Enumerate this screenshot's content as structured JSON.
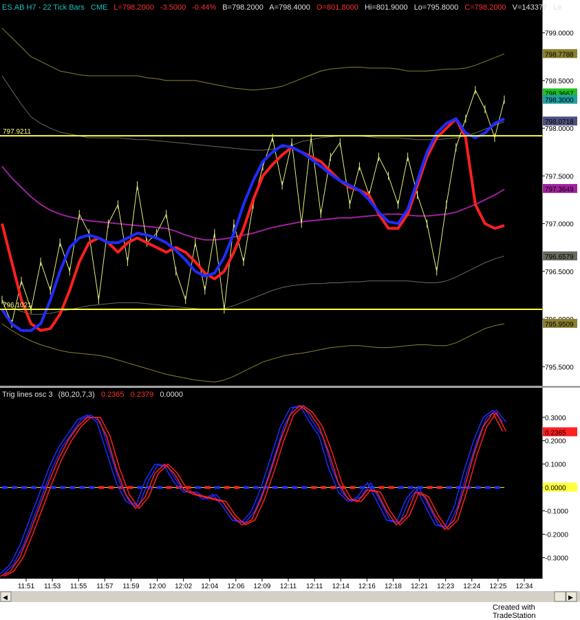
{
  "header": {
    "symbol": "ES.AB H7 - 22 Tick Bars",
    "exchange": "CME",
    "last": "L=798.2000",
    "change": "-3.5000",
    "change_pct": "-0.44%",
    "bid": "B=798.2000",
    "ask": "A=798.4000",
    "open": "O=801.8000",
    "high": "Hi=801.9000",
    "low": "Lo=795.8000",
    "close": "C=798.2000",
    "volume": "V=143377",
    "more": "Le"
  },
  "osc_header": {
    "name": "Trig lines osc 3",
    "params": "(80,20,7,3)",
    "v1": "0.2365",
    "v2": "0.2379",
    "v3": "0.0000"
  },
  "footer": {
    "credit": "Created with TradeStation"
  },
  "colors": {
    "background": "#000000",
    "price_line": "#e8f07a",
    "red_line": "#ff2020",
    "blue_line": "#1f2cff",
    "purple_line": "#a020a0",
    "band_outer": "#8a8030",
    "band_inner": "#6a6a60",
    "hline": "#ffff40"
  },
  "chart_data": [
    {
      "type": "line",
      "title": "",
      "ylim": [
        795.3,
        799.2
      ],
      "y_ticks": [
        "799.0000",
        "798.5000",
        "798.0000",
        "797.5000",
        "797.0000",
        "796.5000",
        "796.0000",
        "795.5000"
      ],
      "y_tick_values": [
        799.0,
        798.5,
        798.0,
        797.5,
        797.0,
        796.5,
        796.0,
        795.5
      ],
      "x_ticks": [
        "11:51",
        "11:53",
        "11:55",
        "11:57",
        "11:59",
        "12:00",
        "12:02",
        "12:04",
        "12:06",
        "12:09",
        "12:11",
        "12:11",
        "12:14",
        "12:16",
        "12:18",
        "12:21",
        "12:23",
        "12:24",
        "12:25",
        "12:34"
      ],
      "horizontal_lines": [
        {
          "label": "797.9211",
          "value": 797.9211
        },
        {
          "label": "796.1021",
          "value": 796.1021
        }
      ],
      "right_tags": [
        {
          "label": "798.7788",
          "value": 798.7788,
          "color": "#8a8030"
        },
        {
          "label": "798.3667",
          "value": 798.3667,
          "color": "#20c020"
        },
        {
          "label": "798.3000",
          "value": 798.3,
          "color": "#20a0a0"
        },
        {
          "label": "798.0718",
          "value": 798.0718,
          "color": "#505080"
        },
        {
          "label": "797.3649",
          "value": 797.3649,
          "color": "#a020a0"
        },
        {
          "label": "796.6579",
          "value": 796.6579,
          "color": "#6a6a60"
        },
        {
          "label": "795.9509",
          "value": 795.9509,
          "color": "#8a8030"
        }
      ],
      "series": [
        {
          "key": "band_upper_outer",
          "values": [
            799.05,
            798.95,
            798.85,
            798.75,
            798.7,
            798.65,
            798.6,
            798.58,
            798.56,
            798.55,
            798.55,
            798.55,
            798.55,
            798.55,
            798.55,
            798.53,
            798.52,
            798.5,
            798.5,
            798.5,
            798.5,
            798.48,
            798.46,
            798.44,
            798.42,
            798.41,
            798.4,
            798.41,
            798.42,
            798.44,
            798.48,
            798.52,
            798.56,
            798.6,
            798.62,
            798.63,
            798.64,
            798.64,
            798.63,
            798.63,
            798.63,
            798.62,
            798.6,
            798.6,
            798.6,
            798.61,
            798.62,
            798.62,
            798.63,
            798.66,
            798.7,
            798.74,
            798.78
          ]
        },
        {
          "key": "band_upper_inner",
          "values": [
            798.55,
            798.4,
            798.25,
            798.12,
            798.05,
            798.0,
            797.96,
            797.94,
            797.92,
            797.9,
            797.9,
            797.9,
            797.9,
            797.89,
            797.88,
            797.88,
            797.87,
            797.86,
            797.85,
            797.84,
            797.83,
            797.82,
            797.81,
            797.8,
            797.79,
            797.78,
            797.77,
            797.77,
            797.78,
            797.8,
            797.82,
            797.86,
            797.88,
            797.9,
            797.91,
            797.92,
            797.92,
            797.92,
            797.91,
            797.9,
            797.9,
            797.9,
            797.89,
            797.88,
            797.88,
            797.88,
            797.89,
            797.9,
            797.92,
            797.95,
            797.99,
            798.03,
            798.07
          ]
        },
        {
          "key": "band_lower_inner",
          "values": [
            796.2,
            796.12,
            796.08,
            796.05,
            796.05,
            796.06,
            796.08,
            796.1,
            796.12,
            796.14,
            796.15,
            796.16,
            796.17,
            796.17,
            796.17,
            796.16,
            796.15,
            796.14,
            796.13,
            796.12,
            796.11,
            796.1,
            796.1,
            796.11,
            796.14,
            796.18,
            796.22,
            796.26,
            796.3,
            796.33,
            796.35,
            796.36,
            796.37,
            796.37,
            796.38,
            796.38,
            796.39,
            796.39,
            796.4,
            796.4,
            796.4,
            796.4,
            796.4,
            796.39,
            796.38,
            796.38,
            796.4,
            796.44,
            796.49,
            796.54,
            796.59,
            796.63,
            796.66
          ]
        },
        {
          "key": "band_lower_outer",
          "values": [
            795.95,
            795.88,
            795.82,
            795.77,
            795.73,
            795.7,
            795.67,
            795.65,
            795.64,
            795.63,
            795.62,
            795.6,
            795.57,
            795.54,
            795.51,
            795.48,
            795.45,
            795.42,
            795.4,
            795.38,
            795.36,
            795.35,
            795.34,
            795.36,
            795.4,
            795.45,
            795.5,
            795.55,
            795.58,
            795.61,
            795.63,
            795.64,
            795.66,
            795.68,
            795.7,
            795.71,
            795.72,
            795.72,
            795.71,
            795.7,
            795.7,
            795.71,
            795.72,
            795.73,
            795.73,
            795.72,
            795.72,
            795.75,
            795.8,
            795.85,
            795.9,
            795.93,
            795.95
          ]
        },
        {
          "key": "purple_avg",
          "values": [
            797.6,
            797.48,
            797.38,
            797.28,
            797.2,
            797.14,
            797.1,
            797.07,
            797.05,
            797.03,
            797.02,
            797.01,
            797.0,
            796.99,
            796.98,
            796.97,
            796.96,
            796.95,
            796.92,
            796.88,
            796.85,
            796.83,
            796.83,
            796.84,
            796.86,
            796.88,
            796.9,
            796.93,
            796.96,
            796.98,
            797.0,
            797.02,
            797.03,
            797.04,
            797.05,
            797.06,
            797.06,
            797.07,
            797.08,
            797.09,
            797.1,
            797.1,
            797.09,
            797.08,
            797.08,
            797.09,
            797.1,
            797.12,
            797.16,
            797.2,
            797.25,
            797.3,
            797.36
          ]
        },
        {
          "key": "price",
          "values": [
            796.2,
            795.95,
            796.4,
            796.1,
            796.6,
            796.3,
            796.8,
            796.5,
            797.1,
            796.9,
            796.2,
            797.0,
            797.2,
            796.6,
            797.4,
            796.8,
            796.9,
            797.1,
            796.5,
            796.2,
            796.8,
            796.3,
            796.9,
            796.1,
            797.0,
            796.6,
            797.2,
            797.6,
            797.9,
            797.4,
            797.85,
            797.0,
            797.9,
            797.1,
            797.7,
            797.85,
            797.2,
            797.6,
            797.3,
            797.7,
            797.5,
            797.2,
            797.7,
            797.3,
            797.0,
            796.5,
            797.2,
            797.8,
            798.1,
            798.4,
            798.2,
            797.9,
            798.3
          ]
        },
        {
          "key": "red_slow",
          "values": [
            797.0,
            796.6,
            796.2,
            795.95,
            795.88,
            795.9,
            796.05,
            796.3,
            796.6,
            796.8,
            796.85,
            796.8,
            796.7,
            796.8,
            796.85,
            796.8,
            796.75,
            796.7,
            796.75,
            796.7,
            796.6,
            796.48,
            796.42,
            796.5,
            796.7,
            796.95,
            797.25,
            797.5,
            797.62,
            797.72,
            797.8,
            797.75,
            797.7,
            797.65,
            797.55,
            797.45,
            797.38,
            797.35,
            797.3,
            797.1,
            796.95,
            796.95,
            797.1,
            797.4,
            797.7,
            797.9,
            798.0,
            798.1,
            797.9,
            797.2,
            797.0,
            796.95,
            796.98
          ]
        },
        {
          "key": "blue_slow",
          "values": [
            796.1,
            795.95,
            795.88,
            795.88,
            795.95,
            796.2,
            796.5,
            796.75,
            796.85,
            796.88,
            796.85,
            796.8,
            796.8,
            796.85,
            796.9,
            796.88,
            796.85,
            796.8,
            796.72,
            796.62,
            796.5,
            796.45,
            796.48,
            796.65,
            796.9,
            797.2,
            797.45,
            797.65,
            797.75,
            797.82,
            797.8,
            797.75,
            797.68,
            797.6,
            797.52,
            797.45,
            797.4,
            797.35,
            797.25,
            797.12,
            797.02,
            797.0,
            797.15,
            797.45,
            797.75,
            797.95,
            798.05,
            798.1,
            797.95,
            797.9,
            797.95,
            798.05,
            798.1
          ]
        }
      ]
    },
    {
      "type": "line",
      "title": "Trig lines osc 3",
      "ylim": [
        -0.39,
        0.37
      ],
      "y_ticks": [
        "0.3000",
        "0.2000",
        "0.1000",
        "0.0000",
        "-0.1000",
        "-0.2000",
        "-0.3000"
      ],
      "y_tick_values": [
        0.3,
        0.2,
        0.1,
        0.0,
        -0.1,
        -0.2,
        -0.3
      ],
      "right_tags": [
        {
          "label": "0.2365",
          "value": 0.2365,
          "color": "#ff2020"
        },
        {
          "label": "0.0000",
          "value": 0.0,
          "color": "#ffff40"
        }
      ],
      "series": [
        {
          "key": "osc_blue",
          "values": [
            -0.37,
            -0.33,
            -0.25,
            -0.14,
            -0.03,
            0.08,
            0.17,
            0.23,
            0.29,
            0.31,
            0.28,
            0.15,
            0.02,
            -0.06,
            -0.08,
            0.03,
            0.1,
            0.09,
            0.02,
            -0.02,
            -0.02,
            -0.05,
            -0.03,
            -0.08,
            -0.14,
            -0.15,
            -0.1,
            0.0,
            0.13,
            0.26,
            0.34,
            0.35,
            0.28,
            0.22,
            0.08,
            -0.02,
            -0.06,
            -0.04,
            0.02,
            -0.06,
            -0.14,
            -0.15,
            -0.05,
            0.0,
            -0.08,
            -0.16,
            -0.17,
            -0.08,
            0.07,
            0.2,
            0.3,
            0.33,
            0.28
          ]
        },
        {
          "key": "osc_red",
          "values": [
            -0.38,
            -0.36,
            -0.3,
            -0.2,
            -0.09,
            0.02,
            0.12,
            0.2,
            0.26,
            0.3,
            0.3,
            0.22,
            0.08,
            -0.03,
            -0.09,
            -0.04,
            0.06,
            0.1,
            0.06,
            -0.01,
            -0.03,
            -0.04,
            -0.05,
            -0.06,
            -0.12,
            -0.16,
            -0.14,
            -0.05,
            0.07,
            0.2,
            0.31,
            0.35,
            0.32,
            0.26,
            0.15,
            0.02,
            -0.05,
            -0.06,
            -0.01,
            -0.02,
            -0.1,
            -0.16,
            -0.12,
            -0.02,
            -0.04,
            -0.12,
            -0.18,
            -0.14,
            -0.01,
            0.14,
            0.26,
            0.32,
            0.24
          ]
        }
      ]
    }
  ]
}
